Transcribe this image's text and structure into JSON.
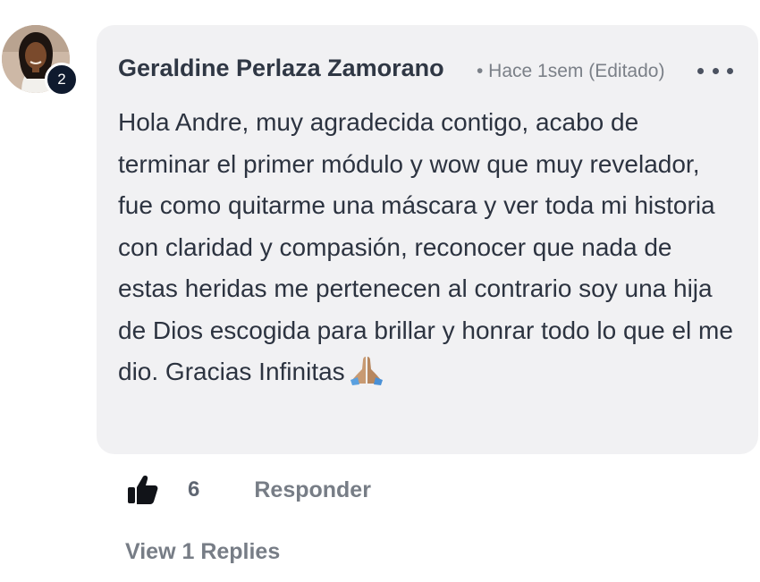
{
  "comment": {
    "author": "Geraldine Perlaza Zamorano",
    "meta": "• Hace 1sem (Editado)",
    "level_badge": "2",
    "body": "Hola Andre, muy agradecida contigo, acabo de terminar el primer módulo y wow que muy revelador, fue como quitarme una máscara y ver toda mi historia con claridad y compasión, reconocer que nada de estas heridas me pertenecen al contrario soy una hija de Dios escogida para brillar y honrar todo lo que el me dio. Gracias Infinitas",
    "emoji": "praying-hands"
  },
  "actions": {
    "like_icon": "thumbs-up-icon",
    "like_count": "6",
    "reply_label": "Responder",
    "view_replies_label": "View 1 Replies"
  },
  "colors": {
    "bubble_bg": "#f1f1f3",
    "text": "#2c3340",
    "muted": "#777d86",
    "badge_bg": "#0f1a2e"
  }
}
